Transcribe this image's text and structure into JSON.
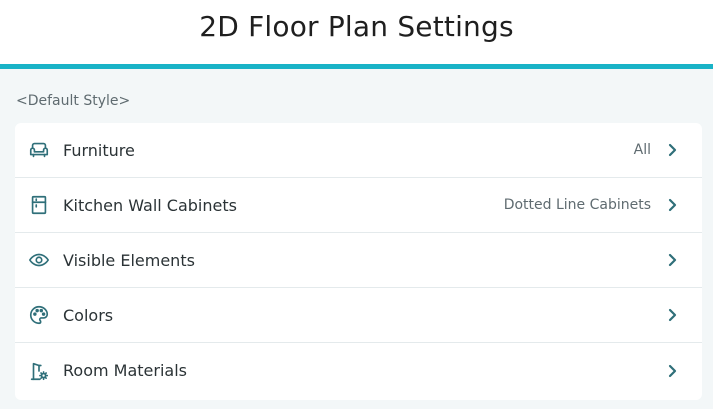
{
  "header": {
    "title": "2D Floor Plan Settings"
  },
  "section": {
    "label": "<Default Style>"
  },
  "colors": {
    "accent": "#19b3c7",
    "icon": "#2f6f79"
  },
  "rows": [
    {
      "label": "Furniture",
      "value": "All",
      "icon": "sofa-icon"
    },
    {
      "label": "Kitchen Wall Cabinets",
      "value": "Dotted Line Cabinets",
      "icon": "cabinet-icon"
    },
    {
      "label": "Visible Elements",
      "value": "",
      "icon": "eye-icon"
    },
    {
      "label": "Colors",
      "value": "",
      "icon": "palette-icon"
    },
    {
      "label": "Room Materials",
      "value": "",
      "icon": "room-materials-icon"
    }
  ]
}
